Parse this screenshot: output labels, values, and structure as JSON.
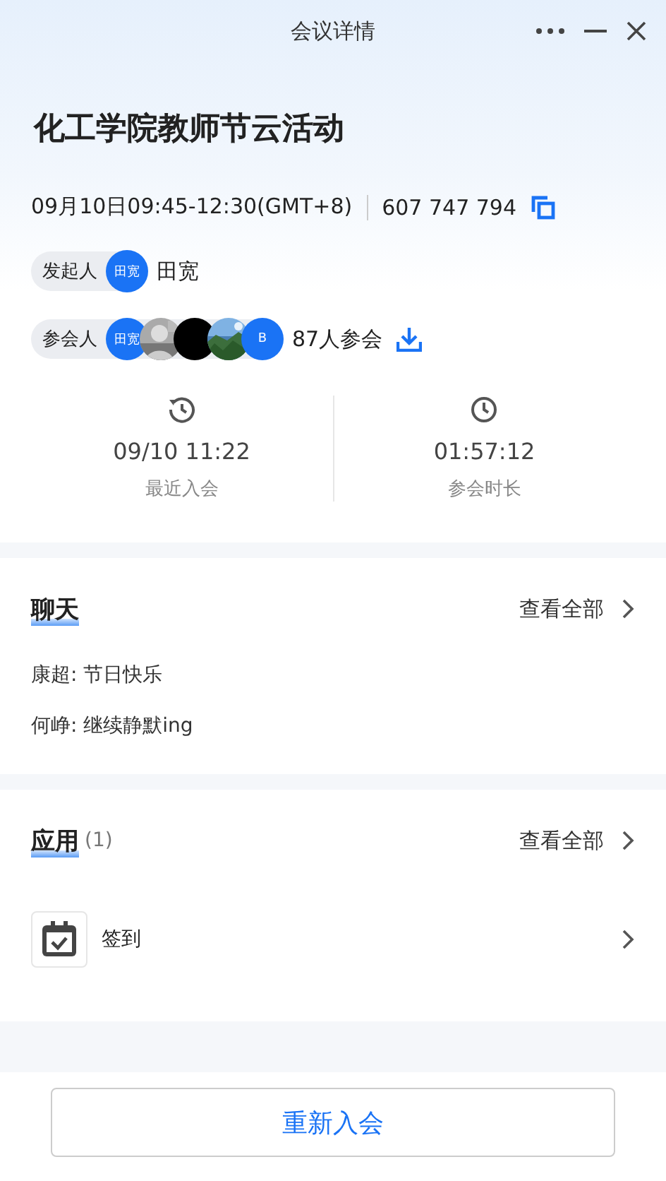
{
  "window": {
    "title": "会议详情"
  },
  "meeting": {
    "title": "化工学院教师节云活动",
    "time": "09月10日09:45-12:30(GMT+8)",
    "id": "607 747 794"
  },
  "initiator": {
    "label": "发起人",
    "avatar": "田宽",
    "name": "田宽"
  },
  "participants": {
    "label": "参会人",
    "avatars": [
      {
        "kind": "initials",
        "text": "田宽"
      },
      {
        "kind": "picture"
      },
      {
        "kind": "dark"
      },
      {
        "kind": "picture"
      },
      {
        "kind": "initials",
        "text": "B"
      }
    ],
    "count": "87人参会"
  },
  "stats": [
    {
      "kind": "history",
      "value": "09/10 11:22",
      "label": "最近入会"
    },
    {
      "kind": "clock",
      "value": "01:57:12",
      "label": "参会时长"
    }
  ],
  "chat": {
    "title": "聊天",
    "view_all": "查看全部",
    "messages": [
      "康超: 节日快乐",
      "何峥: 继续静默ing"
    ]
  },
  "apps": {
    "title": "应用",
    "count": "(1)",
    "view_all": "查看全部",
    "items": [
      {
        "name": "签到"
      }
    ]
  },
  "rejoin_button": "重新入会"
}
